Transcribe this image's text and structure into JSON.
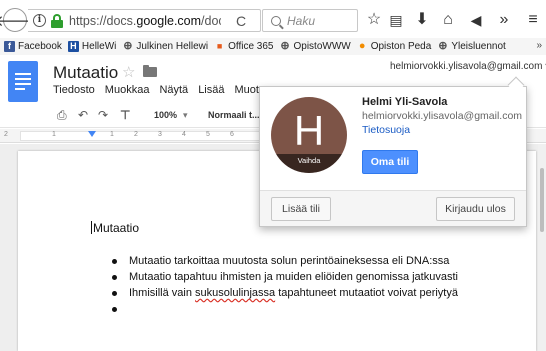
{
  "browser": {
    "url_prefix": "https://docs.",
    "url_domain": "google.com",
    "url_suffix": "/docun",
    "search_placeholder": "Haku",
    "bookmarks": [
      {
        "label": "Facebook",
        "icon": "facebook-icon",
        "color": "#3b5998",
        "glyph": "f"
      },
      {
        "label": "HelleWi",
        "icon": "helle-icon",
        "color": "#1c4fa1",
        "glyph": "H"
      },
      {
        "label": "Julkinen Hellewi",
        "icon": "globe-icon",
        "color": "#555555",
        "glyph": "⊕"
      },
      {
        "label": "Office 365",
        "icon": "office-icon",
        "color": "#e65b1c",
        "glyph": "■"
      },
      {
        "label": "OpistoWWW",
        "icon": "globe-icon",
        "color": "#555555",
        "glyph": "⊕"
      },
      {
        "label": "Opiston Peda",
        "icon": "moodle-icon",
        "color": "#f28c00",
        "glyph": "●"
      },
      {
        "label": "Yleisluennot",
        "icon": "globe-icon",
        "color": "#555555",
        "glyph": "⊕"
      }
    ],
    "bookmarks_more": "»"
  },
  "docs": {
    "title": "Mutaatio",
    "menu": [
      "Tiedosto",
      "Muokkaa",
      "Näytä",
      "Lisää",
      "Muoto"
    ],
    "account_email": "helmiorvokki.ylisavola@gmail.com ▾",
    "zoom": "100%",
    "style": "Normaali t...",
    "ruler_ticks": [
      "2",
      "1",
      "1",
      "2",
      "3",
      "4",
      "5",
      "6"
    ]
  },
  "document": {
    "heading": "Mutaatio",
    "bullets": [
      {
        "text": "Mutaatio tarkoittaa muutosta solun perintöaineksessa eli DNA:ssa"
      },
      {
        "text": "Mutaatio tapahtuu ihmisten ja muiden eliöiden genomissa jatkuvasti"
      },
      {
        "pre": "Ihmisillä vain ",
        "misspelled": "sukusolulinjassa",
        "post": " tapahtuneet mutaatiot voivat periytyä"
      },
      {
        "text": ""
      }
    ]
  },
  "popup": {
    "avatar_letter": "H",
    "change_label": "Vaihda",
    "name": "Helmi Yli-Savola",
    "email": "helmiorvokki.ylisavola@gmail.com",
    "privacy": "Tietosuoja",
    "my_account": "Oma tili",
    "add_account": "Lisää tili",
    "sign_out": "Kirjaudu ulos"
  },
  "colors": {
    "docs_blue": "#4285f4",
    "avatar_bg": "#7d5447",
    "primary_button": "#4d90fe",
    "link": "#1a5bc4"
  }
}
